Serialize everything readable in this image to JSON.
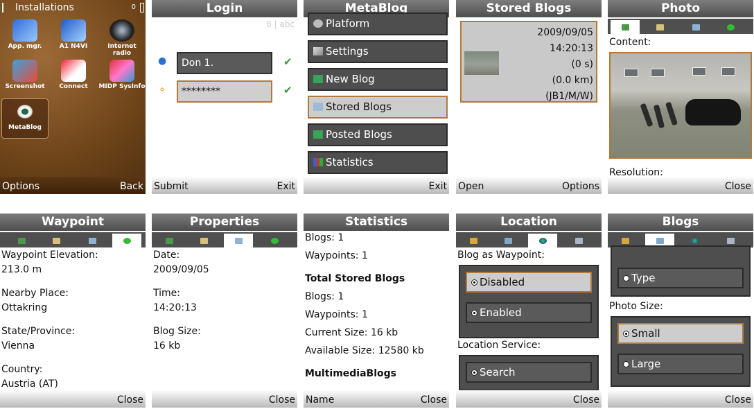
{
  "installations": {
    "title": "Installations",
    "status_right": "0",
    "apps": [
      {
        "label": "App. mgr."
      },
      {
        "label": "A1 N4VI"
      },
      {
        "label": "Internet radio"
      },
      {
        "label": "Screenshot"
      },
      {
        "label": "Connect"
      },
      {
        "label": "MIDP SysInfo"
      },
      {
        "label": "MetaBlog"
      }
    ],
    "lsk": "Options",
    "rsk": "Back"
  },
  "login": {
    "title": "Login",
    "indicator": "8 | abc",
    "username": "Don 1.",
    "password": "********",
    "lsk": "Submit",
    "rsk": "Exit"
  },
  "metablog": {
    "title": "MetaBlog",
    "items": [
      {
        "label": "Platform"
      },
      {
        "label": "Settings"
      },
      {
        "label": "New Blog"
      },
      {
        "label": "Stored Blogs"
      },
      {
        "label": "Posted Blogs"
      },
      {
        "label": "Statistics"
      }
    ],
    "rsk": "Exit"
  },
  "stored": {
    "title": "Stored Blogs",
    "date": "2009/09/05",
    "time": "14:20:13",
    "duration": "(0 s)",
    "distance": "(0.0 km)",
    "code": "(JB1/M/W)",
    "lsk": "Open",
    "rsk": "Options"
  },
  "photo": {
    "title": "Photo",
    "content_label": "Content:",
    "resolution_label": "Resolution:",
    "rsk": "Close"
  },
  "waypoint": {
    "title": "Waypoint",
    "elevation_label": "Waypoint Elevation:",
    "elevation": "213.0 m",
    "nearby_label": "Nearby Place:",
    "nearby": "Ottakring",
    "state_label": "State/Province:",
    "state": "Vienna",
    "country_label": "Country:",
    "country": "Austria (AT)",
    "rsk": "Close"
  },
  "properties": {
    "title": "Properties",
    "date_label": "Date:",
    "date": "2009/09/05",
    "time_label": "Time:",
    "time": "14:20:13",
    "size_label": "Blog Size:",
    "size": "16 kb",
    "rsk": "Close"
  },
  "statistics": {
    "title": "Statistics",
    "blogs": "Blogs: 1",
    "waypoints": "Waypoints: 1",
    "total_header": "Total Stored Blogs",
    "total_blogs": "Blogs: 1",
    "total_waypoints": "Waypoints: 1",
    "current_size": "Current Size: 16 kb",
    "available_size": "Available Size: 12580 kb",
    "multimedia_header": "MultimediaBlogs",
    "lsk": "Name",
    "rsk": "Close"
  },
  "location": {
    "title": "Location",
    "waypoint_label": "Blog as Waypoint:",
    "opt_disabled": "Disabled",
    "opt_enabled": "Enabled",
    "service_label": "Location Service:",
    "opt_search": "Search",
    "rsk": "Close"
  },
  "blogs": {
    "title": "Blogs",
    "opt_type": "Type",
    "photo_size_label": "Photo Size:",
    "opt_small": "Small",
    "opt_large": "Large",
    "rsk": "Close"
  }
}
